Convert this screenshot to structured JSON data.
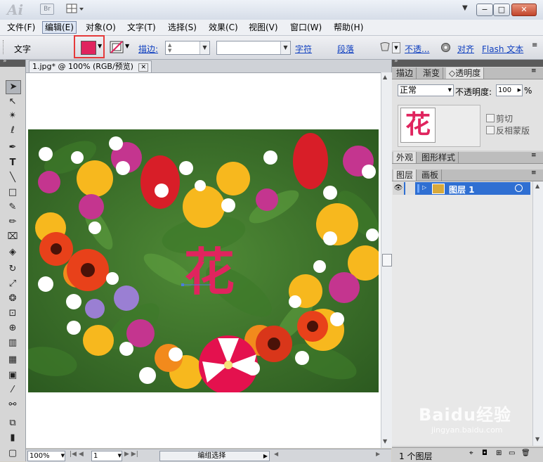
{
  "app": {
    "logo_text": "Ai",
    "bridge_label": "Br"
  },
  "menu": {
    "items": [
      {
        "label": "文件(F)"
      },
      {
        "label": "编辑(E)"
      },
      {
        "label": "对象(O)"
      },
      {
        "label": "文字(T)"
      },
      {
        "label": "选择(S)"
      },
      {
        "label": "效果(C)"
      },
      {
        "label": "视图(V)"
      },
      {
        "label": "窗口(W)"
      },
      {
        "label": "帮助(H)"
      }
    ]
  },
  "control_bar": {
    "mode_label": "文字",
    "fill_color": "#e0245e",
    "stroke_label": "描边:",
    "char_link": "字符",
    "para_link": "段落",
    "opacity_link": "不透...",
    "align_link": "对齐",
    "flash_link": "Flash 文本"
  },
  "document": {
    "tab_label": "1.jpg* @ 100% (RGB/预览)",
    "close_glyph": "✕",
    "art_text": "花",
    "art_text_color": "#e0245e"
  },
  "status": {
    "zoom": "100%",
    "page": "1",
    "mode": "编组选择"
  },
  "transparency_panel": {
    "tabs": [
      {
        "label": "描边"
      },
      {
        "label": "渐变"
      },
      {
        "label": "◇透明度"
      }
    ],
    "blend_mode": "正常",
    "opacity_label": "不透明度:",
    "opacity_value": "100",
    "opacity_unit": "%",
    "clip_label": "剪切",
    "invert_label": "反相蒙版",
    "thumb_text": "花"
  },
  "appearance_panel": {
    "tabs": [
      {
        "label": "外观"
      },
      {
        "label": "图形样式"
      }
    ]
  },
  "layers_panel": {
    "tabs": [
      {
        "label": "图层"
      },
      {
        "label": "画板"
      }
    ],
    "layer_name": "图层 1",
    "layer_count": "1 个图层"
  },
  "watermark": {
    "brand": "Baidu经验",
    "url": "jingyan.baidu.com"
  }
}
